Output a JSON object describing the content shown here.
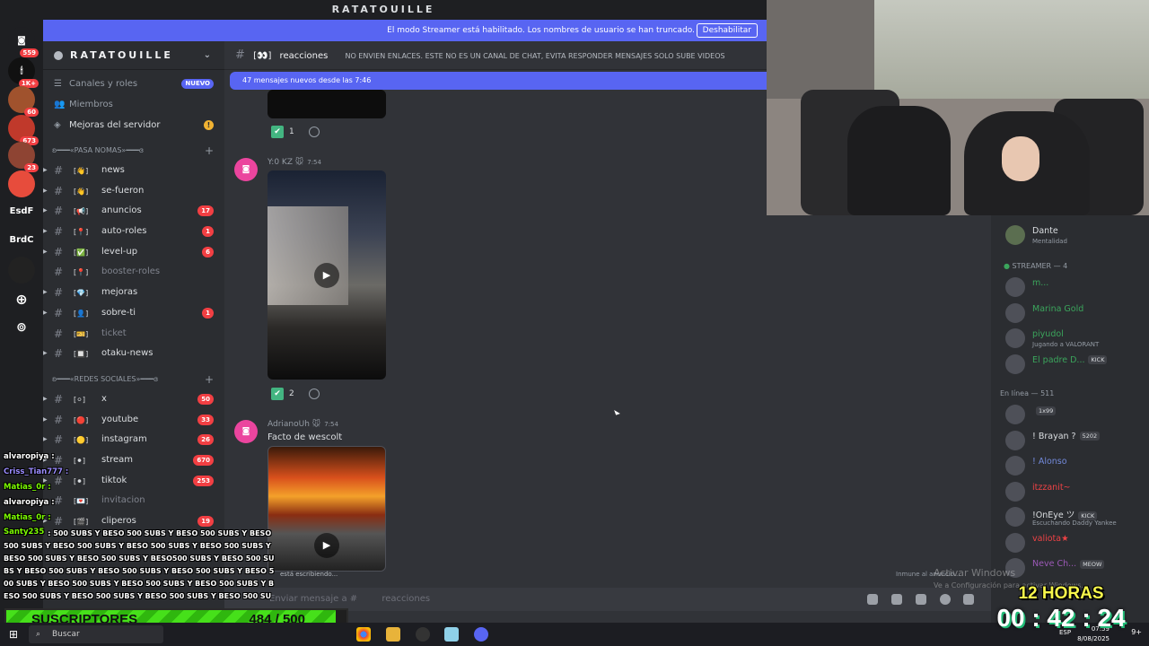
{
  "app": {
    "window_title": "RATATOUILLE"
  },
  "rail": {
    "items": [
      {
        "name": "discord-home",
        "label": "",
        "badge": "559"
      },
      {
        "name": "server-1",
        "label": "",
        "badge": "1K+"
      },
      {
        "name": "server-2",
        "label": "",
        "badge": "60"
      },
      {
        "name": "server-3",
        "label": "",
        "badge": "673"
      },
      {
        "name": "server-4",
        "label": "",
        "badge": "23"
      },
      {
        "name": "server-5",
        "label": "",
        "badge": ""
      },
      {
        "name": "server-esdf",
        "label": "EsdF",
        "badge": ""
      },
      {
        "name": "server-brdc",
        "label": "BrdC",
        "badge": ""
      },
      {
        "name": "server-6",
        "label": "",
        "badge": ""
      }
    ]
  },
  "banner": {
    "text": "El modo Streamer está habilitado. Los nombres de usuario se han truncado.",
    "button": "Deshabilitar"
  },
  "sidebar": {
    "server_name": "RATATOUILLE",
    "top_items": [
      {
        "label": "Canales y roles",
        "pill": "NUEVO"
      },
      {
        "label": "Miembros"
      },
      {
        "label": "Mejoras del servidor",
        "warn": "!"
      }
    ],
    "category1": "ʚ━━━«PASA NOMAS»━━━ɞ",
    "channels1": [
      {
        "name": "news",
        "emoji": "👋",
        "badge": "",
        "muted": false
      },
      {
        "name": "se-fueron",
        "emoji": "👋",
        "badge": "",
        "muted": false
      },
      {
        "name": "anuncios",
        "emoji": "📢",
        "badge": "17",
        "muted": false
      },
      {
        "name": "auto-roles",
        "emoji": "📍",
        "badge": "1",
        "muted": false
      },
      {
        "name": "level-up",
        "emoji": "✅",
        "badge": "6",
        "muted": false
      },
      {
        "name": "booster-roles",
        "emoji": "📍",
        "badge": "",
        "muted": true
      },
      {
        "name": "mejoras",
        "emoji": "💎",
        "badge": "",
        "muted": false
      },
      {
        "name": "sobre-ti",
        "emoji": "👤",
        "badge": "1",
        "muted": false
      },
      {
        "name": "ticket",
        "emoji": "🎫",
        "badge": "",
        "muted": true
      },
      {
        "name": "otaku-news",
        "emoji": "🔲",
        "badge": "",
        "muted": false
      }
    ],
    "category2": "ʚ━━━«REDES SOCIALES»━━━ɞ",
    "channels2": [
      {
        "name": "x",
        "emoji": "⚪",
        "badge": "50",
        "muted": false
      },
      {
        "name": "youtube",
        "emoji": "🔴",
        "badge": "33",
        "muted": false
      },
      {
        "name": "instagram",
        "emoji": "🟡",
        "badge": "26",
        "muted": false
      },
      {
        "name": "stream",
        "emoji": "⚫",
        "badge": "670",
        "muted": false
      },
      {
        "name": "tiktok",
        "emoji": "⚫",
        "badge": "253",
        "muted": false
      },
      {
        "name": "invitacion",
        "emoji": "💌",
        "badge": "",
        "muted": true
      },
      {
        "name": "cliperos",
        "emoji": "🎬",
        "badge": "19",
        "muted": false
      }
    ]
  },
  "chat": {
    "channel": "reacciones",
    "channel_prefix": "[👀]",
    "topic": "NO ENVIEN ENLACES. ESTE NO ES UN CANAL DE CHAT, EVITA RESPONDER MENSAJES SOLO SUBE VIDEOS",
    "new_messages": "47 mensajes nuevos desde las 7:46",
    "reaction1_count": "1",
    "msg2_author": "Y:0 KZ 🐭",
    "msg2_time": "7:54",
    "reaction2_count": "2",
    "msg3_author": "AdrianoUh 🐭",
    "msg3_time": "7:54",
    "msg3_text": "Facto de wescolt",
    "typing": "está escribiendo...",
    "composer_placeholder": "Enviar mensaje a #",
    "composer_channel": "reacciones"
  },
  "members": {
    "top": {
      "name": "Dante",
      "sub": "Mentalidad"
    },
    "streamer_header": "STREAMER — 4",
    "streamers": [
      {
        "name": "m...",
        "sub": "",
        "tag": "",
        "color": "#3ba55c"
      },
      {
        "name": "Marina Gold",
        "sub": "",
        "tag": "",
        "color": "#3ba55c"
      },
      {
        "name": "piyudol",
        "sub": "Jugando a VALORANT",
        "tag": "",
        "color": "#3ba55c"
      },
      {
        "name": "El padre D...",
        "sub": "",
        "tag": "KICK",
        "color": "#3ba55c"
      }
    ],
    "online_header": "En línea — 511",
    "online": [
      {
        "name": "",
        "sub": "",
        "tag": "1x99",
        "color": "#ed4245"
      },
      {
        "name": "! Brayan ?",
        "sub": "",
        "tag": "5202",
        "color": "#dbdee1"
      },
      {
        "name": "! Alonso",
        "sub": "",
        "tag": "",
        "color": "#7289da"
      },
      {
        "name": "itzzanit~",
        "sub": "",
        "tag": "",
        "color": "#ed4245"
      },
      {
        "name": "!OnEye ツ",
        "sub": "Escuchando Daddy Yankee",
        "tag": "KICK",
        "color": "#dbdee1"
      },
      {
        "name": "valiota★",
        "sub": "",
        "tag": "",
        "color": "#ed4245"
      },
      {
        "name": "Neve Ch...",
        "sub": "",
        "tag": "MEOW",
        "color": "#9b59b6"
      }
    ],
    "immune": "Inmune al anuncio..."
  },
  "overlay_chat": {
    "lines": [
      {
        "user": "alvaropiya :",
        "color": "#ffffff"
      },
      {
        "user": "Criss_Tian777 :",
        "color": "#9b8cff"
      },
      {
        "user": "Matias_0r :",
        "color": "#7cfc00"
      },
      {
        "user": "alvaropiya :",
        "color": "#ffffff"
      },
      {
        "user": "Matias_0r :",
        "color": "#7cfc00"
      }
    ],
    "spam_user": "Santy235",
    "spam_text": ": 500 SUBS Y BESO 500 SUBS Y BESO 500 SUBS Y BESO 500 SUBS Y BESO 500 SUBS Y BESO 500 SUBS Y BESO 500 SUBS Y BESO 500 SUBS Y BESO 500 SUBS Y BESO500 SUBS Y BESO 500 SUBS Y BESO 500 SUBS Y BESO 500 SUBS Y BESO 500 SUBS Y BESO 500 SUBS Y BESO 500 SUBS Y BESO 500 SUBS Y BESO 500 SUBS Y BESO 500 SUBS Y BESO 500 SUBS Y BESO 500 SUBS Y BESO 500 SU"
  },
  "subs_goal": {
    "label": "SUSCRIPTORES",
    "count": "484 / 500",
    "progress": 0.968
  },
  "timer": {
    "label": "12 HORAS",
    "time": "00 : 42 : 24"
  },
  "windows": {
    "activate_title": "Activar Windows",
    "activate_sub": "Ve a Configuración para activar Windows."
  },
  "taskbar": {
    "search": "Buscar",
    "lang": "ESP",
    "time": "07:59",
    "date": "8/08/2025",
    "notif": "9+"
  }
}
